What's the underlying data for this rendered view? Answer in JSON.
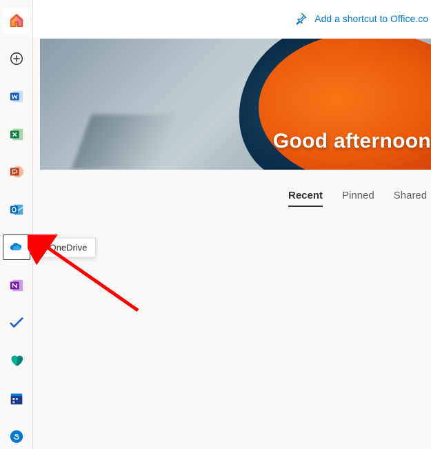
{
  "topbar": {
    "shortcut_label": "Add a shortcut to Office.co"
  },
  "hero": {
    "greeting": "Good afternoon"
  },
  "tabs": {
    "recent": "Recent",
    "pinned": "Pinned",
    "shared": "Shared"
  },
  "sidebar": {
    "home": "Home",
    "create": "Create",
    "word": "Word",
    "excel": "Excel",
    "powerpoint": "PowerPoint",
    "outlook": "Outlook",
    "onedrive": "OneDrive",
    "onenote": "OneNote",
    "todo": "To Do",
    "family": "Family Safety",
    "calendar": "Calendar",
    "skype": "Skype"
  },
  "tooltip": {
    "onedrive": "OneDrive"
  }
}
